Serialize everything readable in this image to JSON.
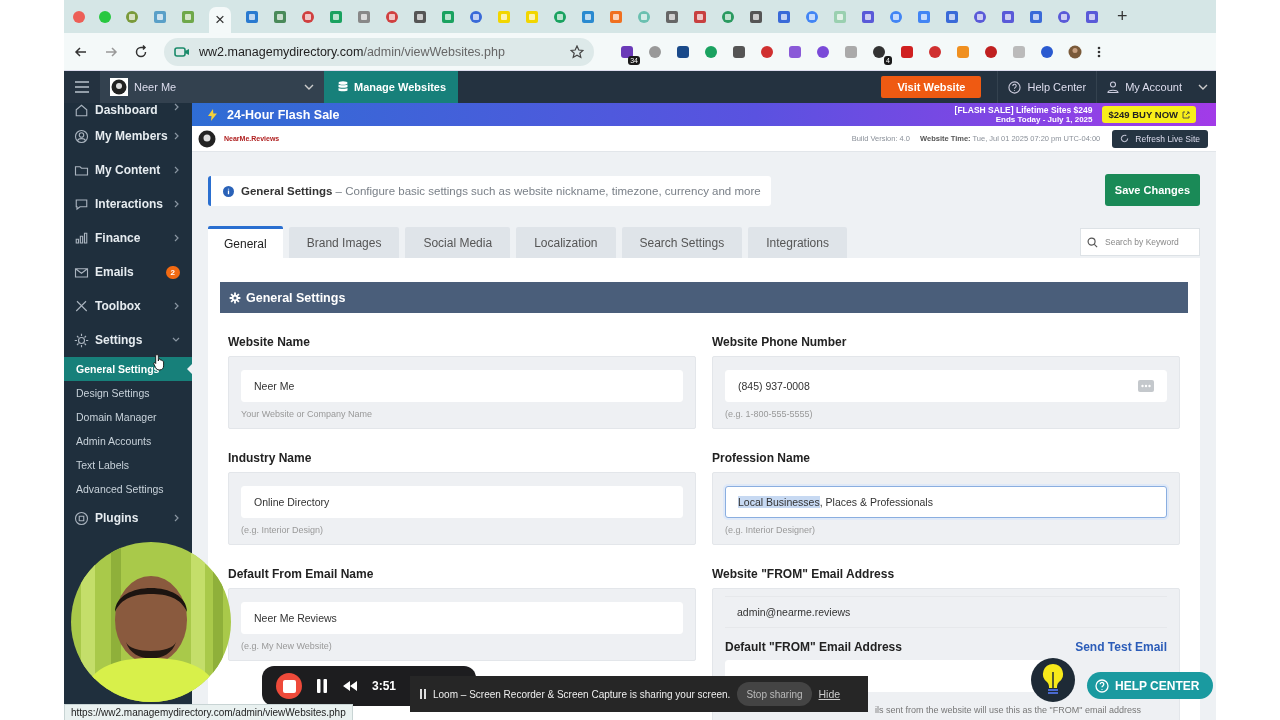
{
  "browser": {
    "tabs": [
      {
        "selected": false
      },
      {
        "selected": false
      },
      {
        "selected": false
      },
      {
        "selected": true
      },
      {
        "selected": false
      },
      {
        "selected": false
      },
      {
        "selected": false
      },
      {
        "selected": false
      },
      {
        "selected": false
      },
      {
        "selected": false
      },
      {
        "selected": false
      },
      {
        "selected": false
      },
      {
        "selected": false
      },
      {
        "selected": false
      },
      {
        "selected": false
      },
      {
        "selected": false
      },
      {
        "selected": false
      },
      {
        "selected": false
      },
      {
        "selected": false
      },
      {
        "selected": false
      },
      {
        "selected": false
      },
      {
        "selected": false
      },
      {
        "selected": false
      },
      {
        "selected": false
      },
      {
        "selected": false
      },
      {
        "selected": false
      },
      {
        "selected": false
      },
      {
        "selected": false
      },
      {
        "selected": false
      },
      {
        "selected": false
      },
      {
        "selected": false
      },
      {
        "selected": false
      },
      {
        "selected": false
      },
      {
        "selected": false
      },
      {
        "selected": false
      }
    ],
    "close_glyph": "×",
    "new_tab": "+",
    "address": {
      "host": "ww2.managemydirectory.com",
      "path": "/admin/viewWebsites.php"
    },
    "extension_badges": [
      {
        "text": "34"
      },
      {
        "text": "4"
      }
    ]
  },
  "header": {
    "site": "Neer Me",
    "manage": "Manage Websites",
    "visit": "Visit Website",
    "help": "Help Center",
    "account": "My Account"
  },
  "sidebar": {
    "items": [
      {
        "label": "Dashboard",
        "expanded": false
      },
      {
        "label": "My Members",
        "expanded": false
      },
      {
        "label": "My Content",
        "expanded": false
      },
      {
        "label": "Interactions",
        "expanded": false
      },
      {
        "label": "Finance",
        "expanded": false
      },
      {
        "label": "Emails",
        "badge": "2"
      },
      {
        "label": "Toolbox",
        "expanded": false
      },
      {
        "label": "Settings",
        "expanded": true,
        "children": [
          {
            "label": "General Settings",
            "selected": true
          },
          {
            "label": "Design Settings",
            "selected": false
          },
          {
            "label": "Domain Manager",
            "selected": false
          },
          {
            "label": "Admin Accounts",
            "selected": false
          },
          {
            "label": "Text Labels",
            "selected": false
          },
          {
            "label": "Advanced Settings",
            "selected": false
          }
        ]
      },
      {
        "label": "Plugins",
        "expanded": false
      }
    ]
  },
  "promo": {
    "title": "24-Hour Flash Sale",
    "headline": "[FLASH SALE] Lifetime Sites $249",
    "ends": "Ends Today - July 1, 2025",
    "cta": "$249 BUY NOW"
  },
  "topbar": {
    "logo_text": "NearMe.Reviews",
    "build": "Build Version: 4.0",
    "time_label": "Website Time:",
    "time": "Tue, Jul 01 2025 07:20 pm UTC-04:00",
    "refresh": "Refresh Live Site"
  },
  "notice": {
    "title": "General Settings",
    "text": "– Configure basic settings such as website nickname, timezone, currency and more"
  },
  "save": "Save Changes",
  "tabs": [
    {
      "label": "General",
      "selected": true
    },
    {
      "label": "Brand Images",
      "selected": false
    },
    {
      "label": "Social Media",
      "selected": false
    },
    {
      "label": "Localization",
      "selected": false
    },
    {
      "label": "Search Settings",
      "selected": false
    },
    {
      "label": "Integrations",
      "selected": false
    }
  ],
  "search": {
    "placeholder": "Search by Keyword"
  },
  "section": {
    "title": "General Settings"
  },
  "fields": [
    {
      "kind": "text",
      "label": "Website Name",
      "value_parts": [
        {
          "text": "Neer Me",
          "highlighted": false
        }
      ],
      "hint": "Your Website or Company Name",
      "focused": false,
      "autofill": false
    },
    {
      "kind": "text",
      "label": "Website Phone Number",
      "value_parts": [
        {
          "text": "(845) 937-0008",
          "highlighted": false
        }
      ],
      "hint": "(e.g. 1-800-555-5555)",
      "focused": false,
      "autofill": true
    },
    {
      "kind": "text",
      "label": "Industry Name",
      "value_parts": [
        {
          "text": "Online Directory",
          "highlighted": false
        }
      ],
      "hint": "(e.g. Interior Design)",
      "focused": false,
      "autofill": false
    },
    {
      "kind": "text",
      "label": "Profession Name",
      "value_parts": [
        {
          "text": "Local Businesses",
          "highlighted": true
        },
        {
          "text": ", Places & Professionals",
          "highlighted": false
        }
      ],
      "hint": "(e.g. Interior Designer)",
      "focused": true,
      "autofill": false
    },
    {
      "kind": "text",
      "label": "Default From Email Name",
      "value_parts": [
        {
          "text": "Neer Me Reviews",
          "highlighted": false
        }
      ],
      "hint": "(e.g. My New Website)",
      "focused": false,
      "autofill": false
    },
    {
      "kind": "email_group",
      "label": "Website \"FROM\" Email Address",
      "display": "admin@nearme.reviews",
      "sublabel": "Default \"FROM\" Email Address",
      "link": "Send Test Email",
      "hint": "ils sent from the website will use this as the \"FROM\" email address"
    }
  ],
  "recorder": {
    "time": "3:51"
  },
  "share_bar": {
    "message": "Loom – Screen Recorder & Screen Capture is sharing your screen.",
    "stop": "Stop sharing",
    "hide": "Hide"
  },
  "help_button": "HELP CENTER",
  "status_url": "https://ww2.managemydirectory.com/admin/viewWebsites.php"
}
